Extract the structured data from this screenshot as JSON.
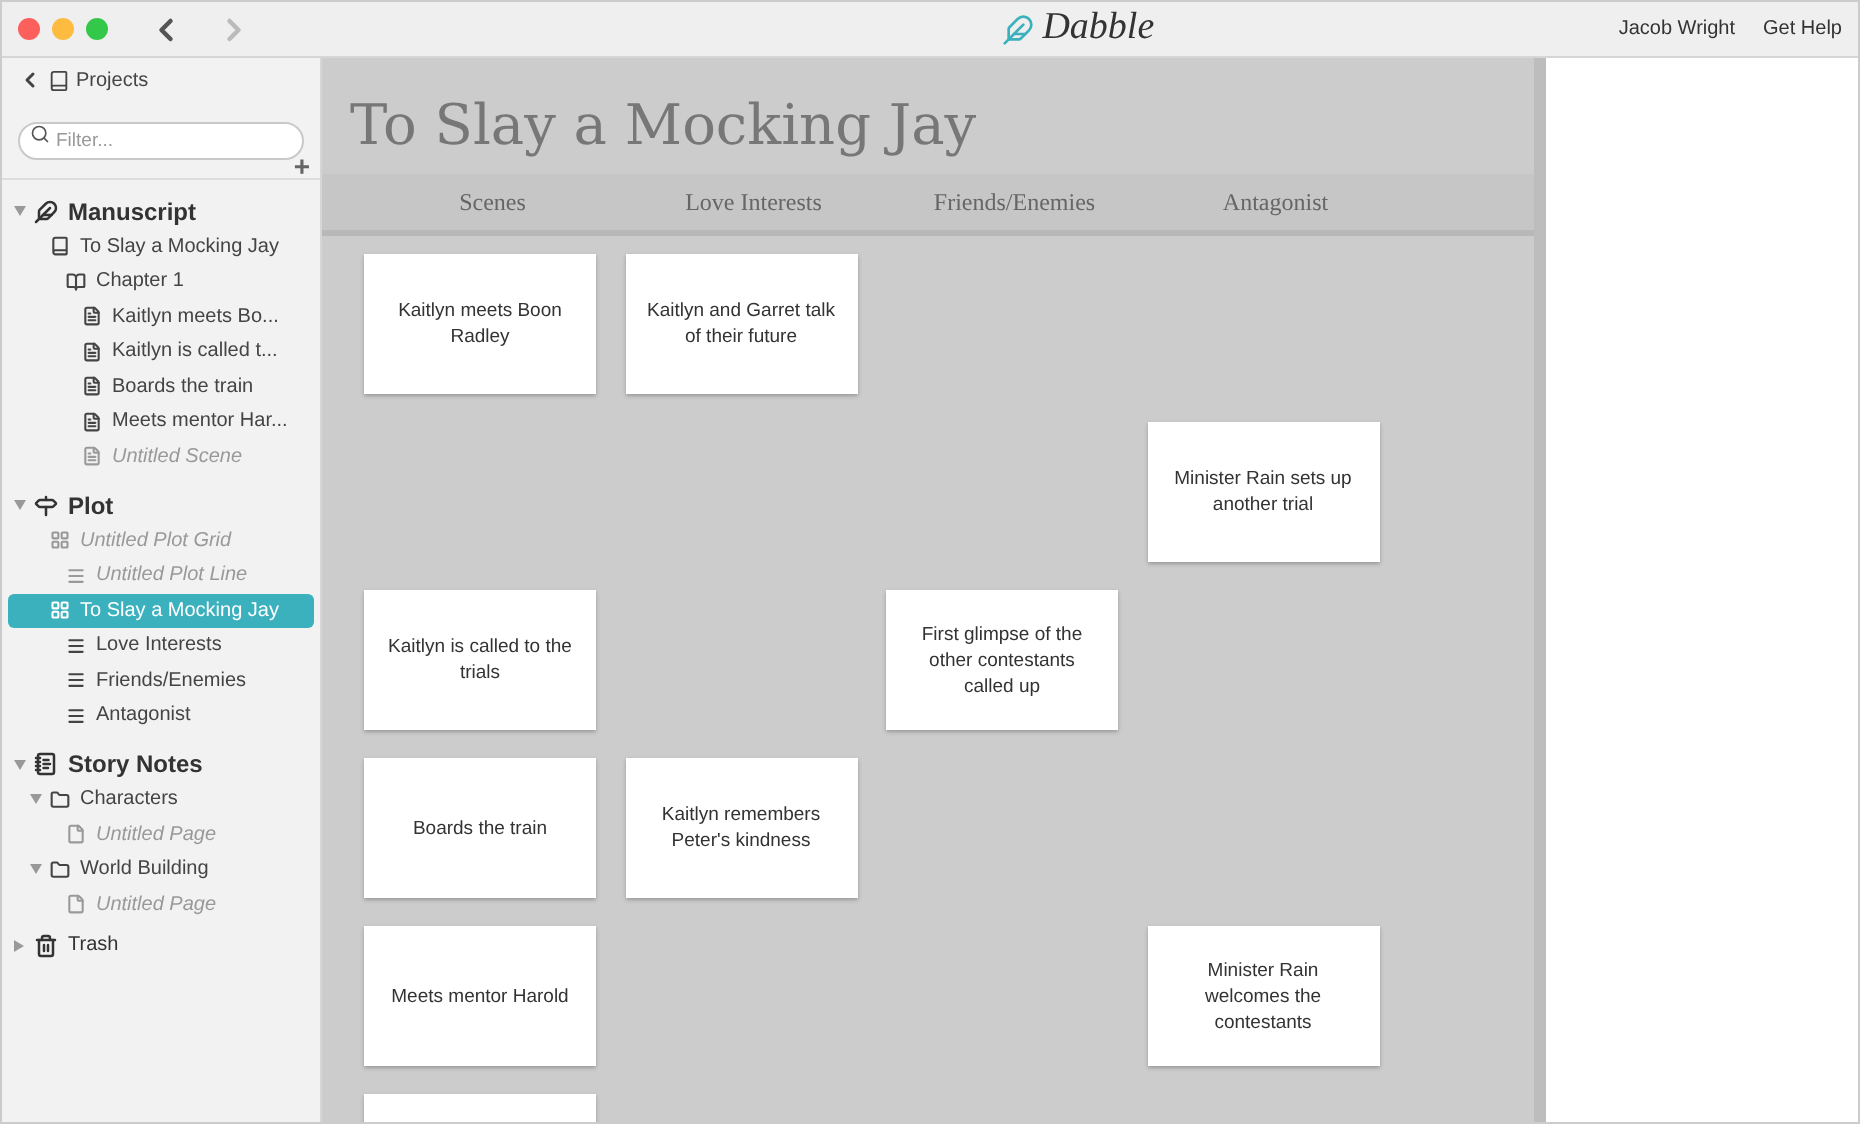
{
  "app": {
    "logo": "Dabble",
    "user": "Jacob Wright",
    "help": "Get Help"
  },
  "sidebar": {
    "back": "Projects",
    "filter": {
      "placeholder": "Filter..."
    },
    "add": "+",
    "tree": [
      {
        "label": "Manuscript",
        "kind": "manuscript",
        "expanded": true,
        "selected": false,
        "untitled": false,
        "children": [
          {
            "label": "To Slay a Mocking Jay",
            "kind": "book",
            "selected": false,
            "untitled": false,
            "children": [
              {
                "label": "Chapter 1",
                "kind": "chapter",
                "selected": false,
                "untitled": false,
                "children": [
                  {
                    "label": "Kaitlyn meets Bo...",
                    "kind": "scene",
                    "selected": false,
                    "untitled": false
                  },
                  {
                    "label": "Kaitlyn is called t...",
                    "kind": "scene",
                    "selected": false,
                    "untitled": false
                  },
                  {
                    "label": "Boards the train",
                    "kind": "scene",
                    "selected": false,
                    "untitled": false
                  },
                  {
                    "label": "Meets mentor Har...",
                    "kind": "scene",
                    "selected": false,
                    "untitled": false
                  },
                  {
                    "label": "Untitled Scene",
                    "kind": "scene",
                    "selected": false,
                    "untitled": true
                  }
                ]
              }
            ]
          }
        ]
      },
      {
        "label": "Plot",
        "kind": "plot",
        "expanded": true,
        "selected": false,
        "untitled": false,
        "children": [
          {
            "label": "Untitled Plot Grid",
            "kind": "grid",
            "selected": false,
            "untitled": true,
            "children": [
              {
                "label": "Untitled Plot Line",
                "kind": "line",
                "selected": false,
                "untitled": true
              }
            ]
          },
          {
            "label": "To Slay a Mocking Jay",
            "kind": "grid",
            "selected": true,
            "untitled": false,
            "children": [
              {
                "label": "Love Interests",
                "kind": "line",
                "selected": false,
                "untitled": false
              },
              {
                "label": "Friends/Enemies",
                "kind": "line",
                "selected": false,
                "untitled": false
              },
              {
                "label": "Antagonist",
                "kind": "line",
                "selected": false,
                "untitled": false
              }
            ]
          }
        ]
      },
      {
        "label": "Story Notes",
        "kind": "notes",
        "expanded": true,
        "selected": false,
        "untitled": false,
        "children": [
          {
            "label": "Characters",
            "kind": "folder",
            "expanded": true,
            "selected": false,
            "untitled": false,
            "children": [
              {
                "label": "Untitled Page",
                "kind": "page",
                "selected": false,
                "untitled": true
              }
            ]
          },
          {
            "label": "World Building",
            "kind": "folder",
            "expanded": true,
            "selected": false,
            "untitled": false,
            "children": [
              {
                "label": "Untitled Page",
                "kind": "page",
                "selected": false,
                "untitled": true
              }
            ]
          }
        ]
      },
      {
        "label": "Trash",
        "kind": "trash",
        "expanded": false,
        "selected": false,
        "untitled": false
      }
    ]
  },
  "grid": {
    "title": "To Slay a Mocking Jay",
    "columns": [
      "Scenes",
      "Love Interests",
      "Friends/Enemies",
      "Antagonist"
    ],
    "rows": [
      [
        {
          "text": "Kaitlyn meets Boon Radley"
        },
        {
          "text": "Kaitlyn and Garret talk of their future"
        },
        null,
        null
      ],
      [
        null,
        null,
        null,
        {
          "text": "Minister Rain sets up another trial"
        }
      ],
      [
        {
          "text": "Kaitlyn is called to the trials"
        },
        null,
        {
          "text": "First glimpse of the other contestants called up"
        },
        null
      ],
      [
        {
          "text": "Boards the train"
        },
        {
          "text": "Kaitlyn remembers Peter's kindness"
        },
        null,
        null
      ],
      [
        {
          "text": "Meets mentor Harold"
        },
        null,
        null,
        {
          "text": "Minister Rain welcomes the contestants"
        }
      ],
      [
        {},
        null,
        null,
        null
      ]
    ]
  }
}
